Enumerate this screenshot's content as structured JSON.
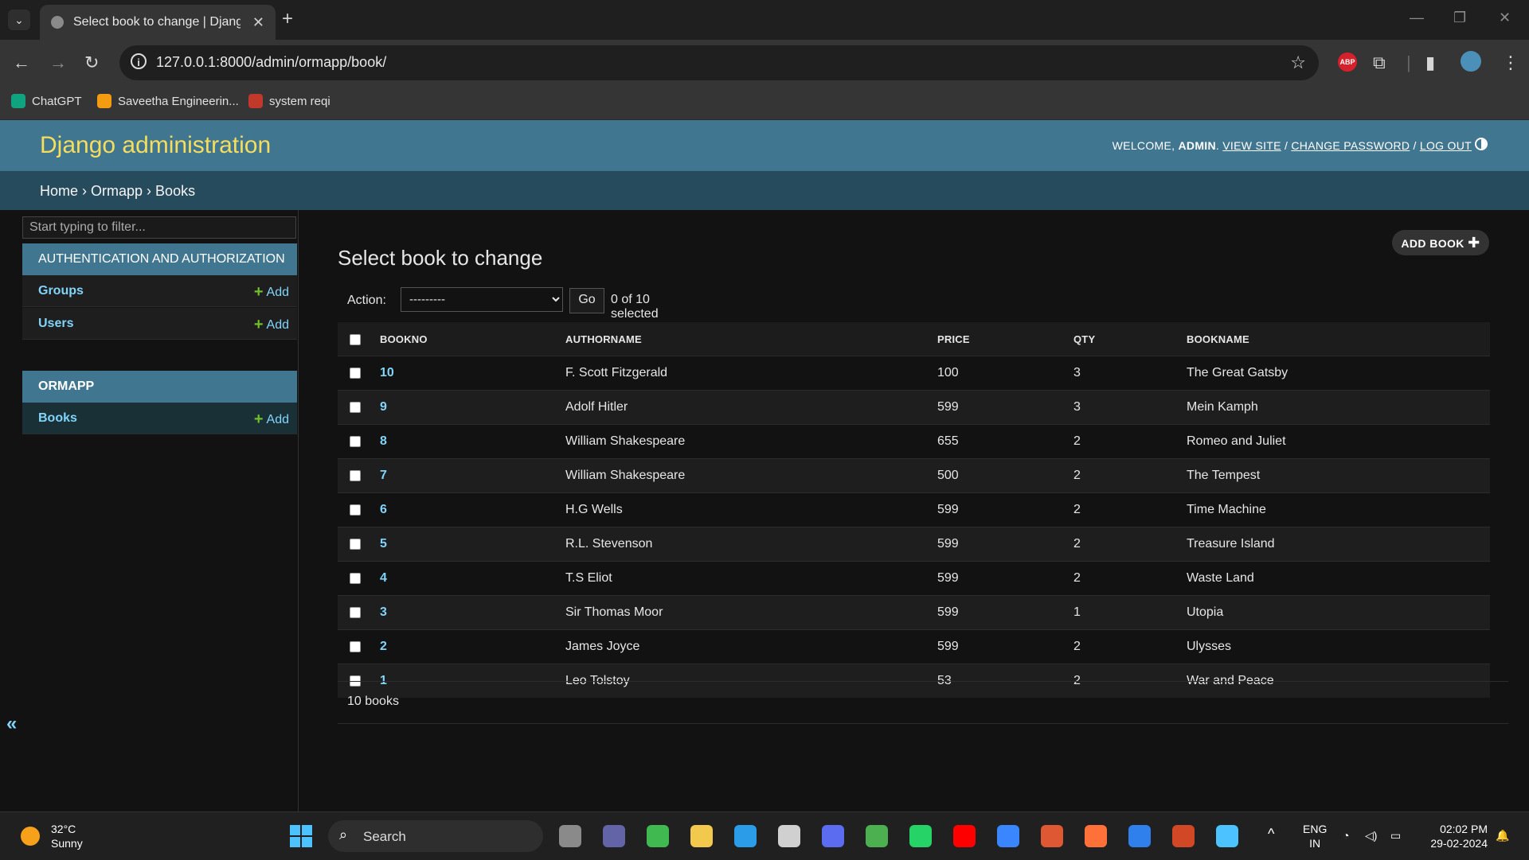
{
  "browser": {
    "tab_title": "Select book to change | Django site admin",
    "url": "127.0.0.1:8000/admin/ormapp/book/",
    "bookmarks": [
      {
        "label": "ChatGPT",
        "icon": "chatgpt-icon",
        "color": "#10a37f"
      },
      {
        "label": "Saveetha Engineerin...",
        "icon": "saveetha-icon",
        "color": "#f39c12"
      },
      {
        "label": "system reqi",
        "icon": "system-req-icon",
        "color": "#c0392b"
      }
    ],
    "abp_label": "ABP"
  },
  "header": {
    "site_title": "Django administration",
    "welcome": "WELCOME,",
    "username": "ADMIN",
    "view_site": "VIEW SITE",
    "change_password": "CHANGE PASSWORD",
    "log_out": "LOG OUT"
  },
  "breadcrumbs": {
    "home": "Home",
    "app": "Ormapp",
    "model": "Books"
  },
  "sidebar": {
    "filter_placeholder": "Start typing to filter...",
    "modules": [
      {
        "caption": "AUTHENTICATION AND AUTHORIZATION",
        "rows": [
          {
            "name": "Groups",
            "add": "Add"
          },
          {
            "name": "Users",
            "add": "Add"
          }
        ]
      },
      {
        "caption": "ORMAPP",
        "rows": [
          {
            "name": "Books",
            "add": "Add"
          }
        ]
      }
    ],
    "collapse_icon": "«"
  },
  "content": {
    "title": "Select book to change",
    "add_button": "ADD BOOK",
    "action_label": "Action:",
    "action_selected": "---------",
    "go": "Go",
    "counter": "0 of 10 selected",
    "columns": [
      "BOOKNO",
      "AUTHORNAME",
      "PRICE",
      "QTY",
      "BOOKNAME"
    ],
    "rows": [
      {
        "bookno": "10",
        "author": "F. Scott Fitzgerald",
        "price": "100",
        "qty": "3",
        "bookname": "The Great Gatsby"
      },
      {
        "bookno": "9",
        "author": "Adolf Hitler",
        "price": "599",
        "qty": "3",
        "bookname": "Mein Kamph"
      },
      {
        "bookno": "8",
        "author": "William Shakespeare",
        "price": "655",
        "qty": "2",
        "bookname": "Romeo and Juliet"
      },
      {
        "bookno": "7",
        "author": "William Shakespeare",
        "price": "500",
        "qty": "2",
        "bookname": "The Tempest"
      },
      {
        "bookno": "6",
        "author": "H.G Wells",
        "price": "599",
        "qty": "2",
        "bookname": "Time Machine"
      },
      {
        "bookno": "5",
        "author": "R.L. Stevenson",
        "price": "599",
        "qty": "2",
        "bookname": "Treasure Island"
      },
      {
        "bookno": "4",
        "author": "T.S Eliot",
        "price": "599",
        "qty": "2",
        "bookname": "Waste Land"
      },
      {
        "bookno": "3",
        "author": "Sir Thomas Moor",
        "price": "599",
        "qty": "1",
        "bookname": "Utopia"
      },
      {
        "bookno": "2",
        "author": "James Joyce",
        "price": "599",
        "qty": "2",
        "bookname": "Ulysses"
      },
      {
        "bookno": "1",
        "author": "Leo Tolstoy",
        "price": "53",
        "qty": "2",
        "bookname": "War and Peace"
      }
    ],
    "paginator": "10 books"
  },
  "taskbar": {
    "temp": "32°C",
    "condition": "Sunny",
    "search": "Search",
    "lang1": "ENG",
    "lang2": "IN",
    "time": "02:02 PM",
    "date": "29-02-2024",
    "apps": [
      {
        "name": "task-view-icon",
        "color": "#8a8a8a"
      },
      {
        "name": "meet-icon",
        "color": "#6264a7"
      },
      {
        "name": "circle-app-icon",
        "color": "#3fb950"
      },
      {
        "name": "file-explorer-icon",
        "color": "#f2c94c"
      },
      {
        "name": "edge-icon",
        "color": "#2b9de8"
      },
      {
        "name": "store-icon",
        "color": "#d0d0d0"
      },
      {
        "name": "vpn-icon",
        "color": "#5b6cf0"
      },
      {
        "name": "chrome-icon",
        "color": "#4caf50"
      },
      {
        "name": "whatsapp-icon",
        "color": "#25d366"
      },
      {
        "name": "youtube-icon",
        "color": "#ff0000"
      },
      {
        "name": "app-icon",
        "color": "#3a86ff"
      },
      {
        "name": "duckduckgo-icon",
        "color": "#de5833"
      },
      {
        "name": "firefox-icon",
        "color": "#ff7139"
      },
      {
        "name": "vscode-icon",
        "color": "#2f80ed"
      },
      {
        "name": "powerpoint-icon",
        "color": "#d24726"
      },
      {
        "name": "notepad-icon",
        "color": "#4cc2ff"
      }
    ]
  }
}
